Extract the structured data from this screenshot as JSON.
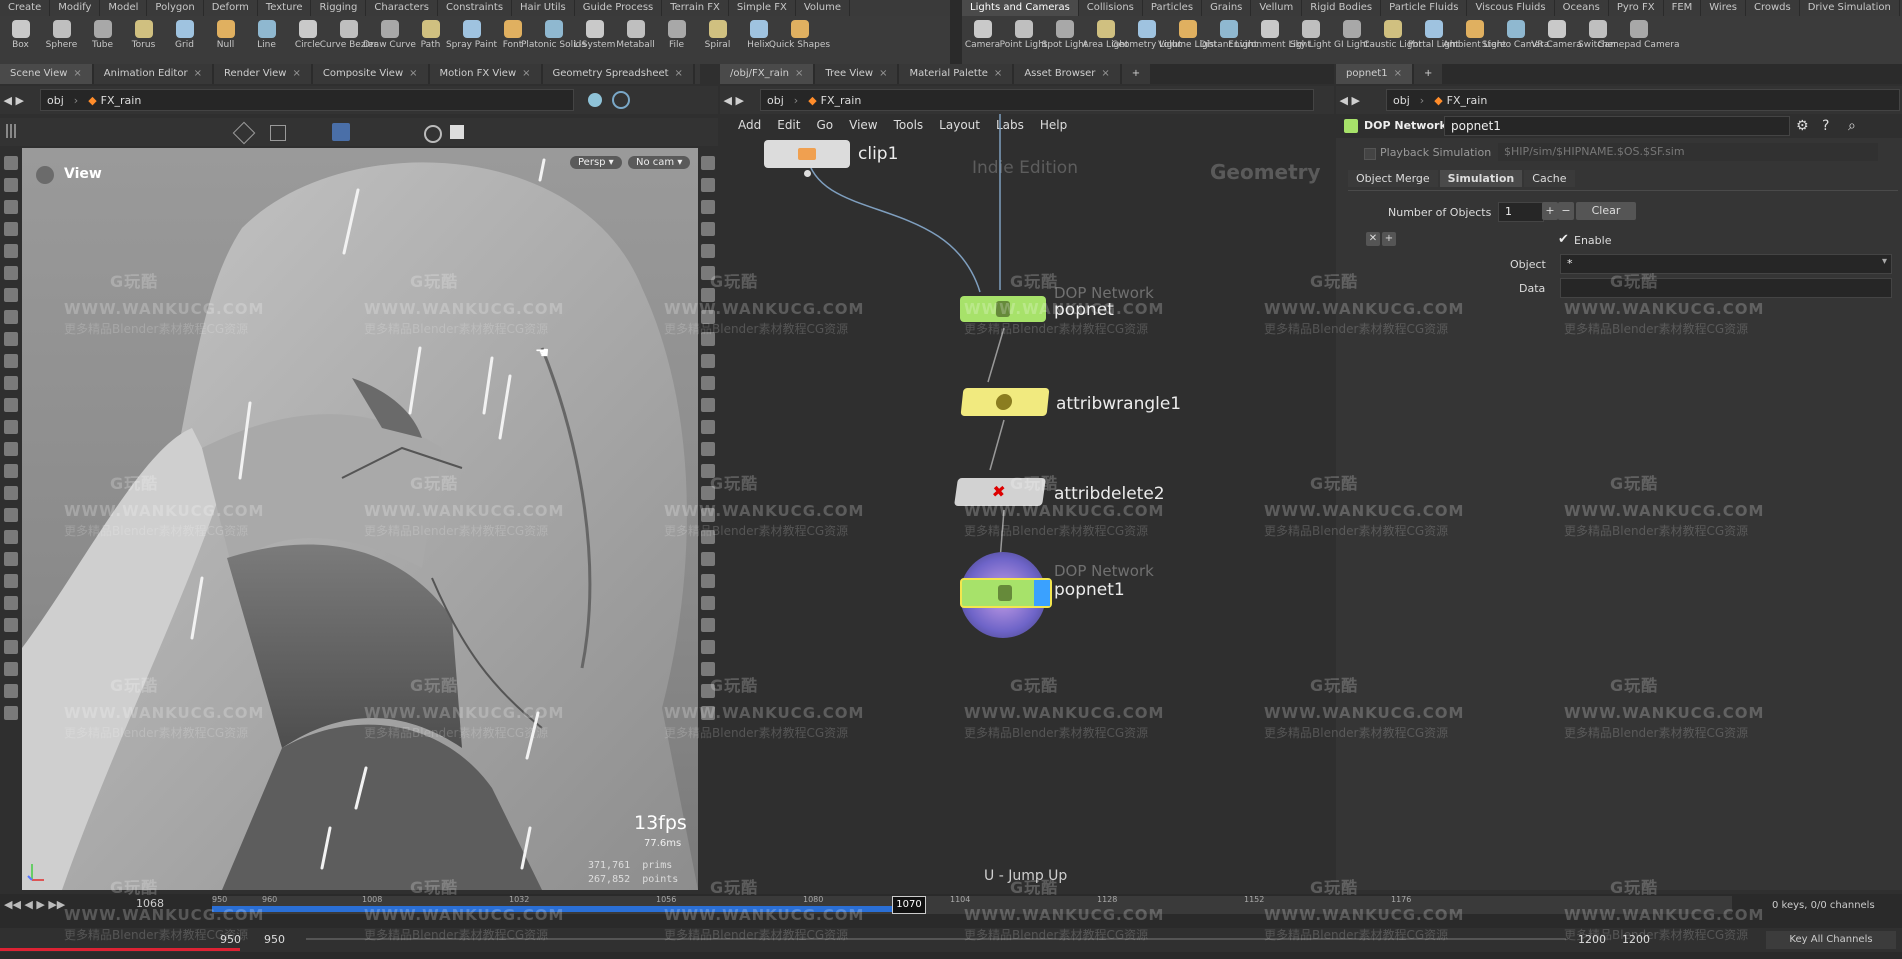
{
  "shelf_left": {
    "tabs": [
      "Create",
      "Modify",
      "Model",
      "Polygon",
      "Deform",
      "Texture",
      "Rigging",
      "Characters",
      "Constraints",
      "Hair Utils",
      "Guide Process",
      "Terrain FX",
      "Simple FX",
      "Volume"
    ],
    "tools": [
      "Box",
      "Sphere",
      "Tube",
      "Torus",
      "Grid",
      "Null",
      "Line",
      "Circle",
      "Curve Bezier",
      "Draw Curve",
      "Path",
      "Spray Paint",
      "Font",
      "Platonic Solids",
      "L-System",
      "Metaball",
      "File",
      "Spiral",
      "Helix",
      "Quick Shapes"
    ]
  },
  "shelf_right": {
    "tabs": [
      "Lights and Cameras",
      "Collisions",
      "Particles",
      "Grains",
      "Vellum",
      "Rigid Bodies",
      "Particle Fluids",
      "Viscous Fluids",
      "Oceans",
      "Pyro FX",
      "FEM",
      "Wires",
      "Crowds",
      "Drive Simulation"
    ],
    "tools": [
      "Camera",
      "Point Light",
      "Spot Light",
      "Area Light",
      "Geometry Light",
      "Volume Light",
      "Distant Light",
      "Environment Light",
      "Sky Light",
      "GI Light",
      "Caustic Light",
      "Portal Light",
      "Ambient Light",
      "Stereo Camera",
      "VR Camera",
      "Switcher",
      "Gamepad Camera"
    ]
  },
  "pane_left": {
    "tabs": [
      "Scene View",
      "Animation Editor",
      "Render View",
      "Composite View",
      "Motion FX View",
      "Geometry Spreadsheet"
    ],
    "path": [
      "obj",
      "FX_rain"
    ]
  },
  "pane_mid": {
    "tabs": [
      "/obj/FX_rain",
      "Tree View",
      "Material Palette",
      "Asset Browser"
    ],
    "path": [
      "obj",
      "FX_rain"
    ],
    "menu": [
      "Add",
      "Edit",
      "Go",
      "View",
      "Tools",
      "Layout",
      "Labs",
      "Help"
    ]
  },
  "pane_right": {
    "tabs": [
      "popnet1"
    ],
    "path": [
      "obj",
      "FX_rain"
    ]
  },
  "viewport": {
    "label": "View",
    "persp": "Persp ▾",
    "cam": "No cam ▾",
    "fps": "13fps",
    "ms": "77.6ms",
    "prims_value": "371,761",
    "prims_label": "prims",
    "points_value": "267,852",
    "points_label": "points"
  },
  "network": {
    "watermark_edition": "Indie Edition",
    "watermark_context": "Geometry",
    "hint": "U - Jump Up",
    "nodes": [
      {
        "name": "clip1",
        "sub": "",
        "color": "#dcdcdc"
      },
      {
        "name": "popnet",
        "sub": "DOP Network",
        "color": "#a7e26a"
      },
      {
        "name": "attribwrangle1",
        "sub": "",
        "color": "#f1ea7f"
      },
      {
        "name": "attribdelete2",
        "sub": "",
        "color": "#d2d2d2"
      },
      {
        "name": "popnet1",
        "sub": "DOP Network",
        "color": "#a7e26a"
      }
    ]
  },
  "params": {
    "type_label": "DOP Network",
    "node_name": "popnet1",
    "playback_label": "Playback Simulation",
    "sim_path": "$HIP/sim/$HIPNAME.$OS.$SF.sim",
    "tabs": [
      "Object Merge",
      "Simulation",
      "Cache"
    ],
    "active_tab": "Simulation",
    "num_objects_label": "Number of Objects",
    "num_objects_value": "1",
    "clear_label": "Clear",
    "enable_label": "Enable",
    "object_label": "Object",
    "object_value": "*",
    "data_label": "Data"
  },
  "timeline": {
    "current_frame": "1070",
    "start_frame": "950",
    "start_frame2": "950",
    "end_frame": "1200",
    "end_frame2": "1200",
    "left_frame": "1068",
    "ticks": [
      "950",
      "960",
      "1008",
      "1032",
      "1056",
      "1080",
      "1104",
      "1128",
      "1152",
      "1176"
    ],
    "keys_label": "0 keys, 0/0 channels",
    "key_all_label": "Key All Channels"
  },
  "watermark": {
    "logo": "G玩酷",
    "url": "WWW.WANKUCG.COM",
    "tagline": "更多精品Blender素材教程CG资源"
  },
  "colors": {
    "accent_blue": "#2a6fd6",
    "node_green": "#a7e26a",
    "node_yellow": "#f1ea7f",
    "flag_blue": "#3aa1ff"
  }
}
